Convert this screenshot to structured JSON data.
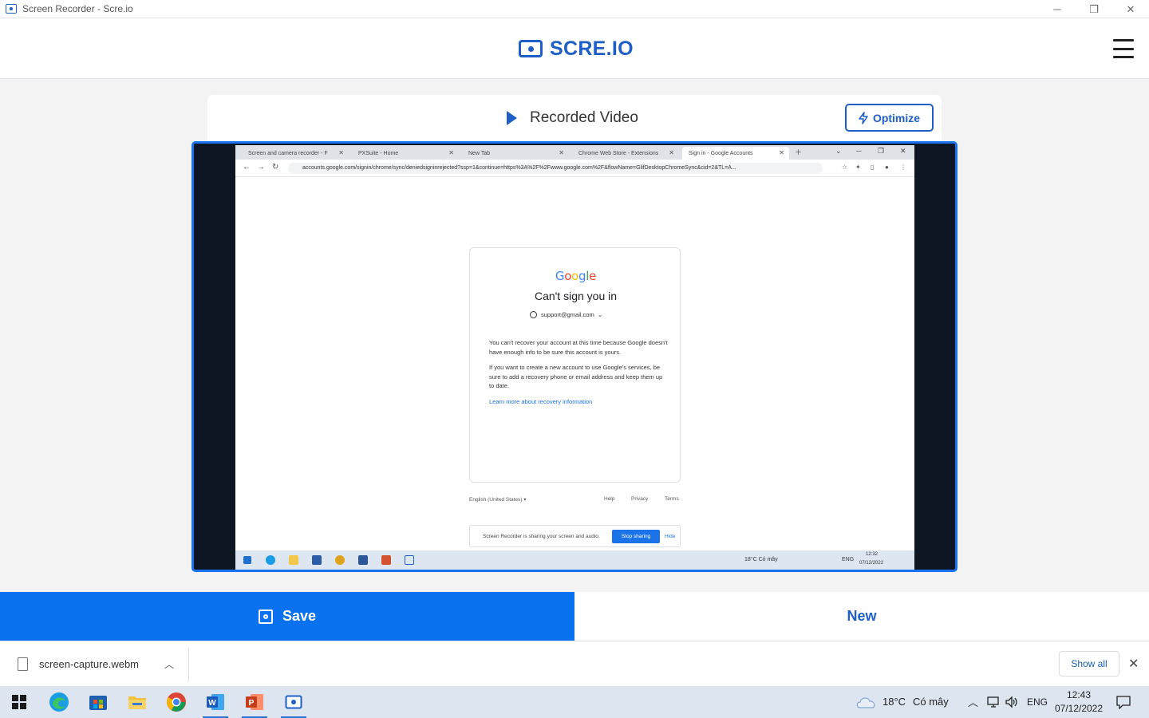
{
  "window": {
    "title": "Screen Recorder - Scre.io",
    "controls": {
      "minimize": "─",
      "maximize": "❐",
      "close": "✕"
    }
  },
  "header": {
    "logo_text": "SCRE.IO"
  },
  "card": {
    "title": "Recorded Video",
    "optimize_label": "Optimize"
  },
  "video": {
    "browser_tabs": [
      "Screen and camera recorder - F",
      "PXSuite - Home",
      "New Tab",
      "Chrome Web Store - Extensions",
      "Sign in - Google Accounts"
    ],
    "url": "accounts.google.com/signin/chrome/sync/deniedsigninrejected?ssp=1&continue=https%3A%2F%2Fwww.google.com%2F&flowName=GlifDesktopChromeSync&cid=2&TL=A...",
    "google": {
      "logo": "Google",
      "title": "Can't sign you in",
      "account": "support@gmail.com",
      "para1": "You can't recover your account at this time because Google doesn't have enough info to be sure this account is yours.",
      "para2": "If you want to create a new account to use Google's services, be sure to add a recovery phone or email address and keep them up to date.",
      "link": "Learn more about recovery information",
      "language": "English (United States)",
      "footer_links": [
        "Help",
        "Privacy",
        "Terms"
      ]
    },
    "share_bar": {
      "text": "Screen Recorder is sharing your screen and audio.",
      "stop": "Stop sharing",
      "hide": "Hide"
    },
    "taskbar": {
      "weather": "18°C  Có mây",
      "lang": "ENG",
      "time": "12:32",
      "date": "07/12/2022"
    }
  },
  "actions": {
    "save_label": "Save",
    "new_label": "New"
  },
  "downloads": {
    "file_name": "screen-capture.webm",
    "show_all": "Show all"
  },
  "taskbar": {
    "weather": "18°C",
    "weather_desc": "Có mây",
    "lang": "ENG",
    "time": "12:43",
    "date": "07/12/2022"
  },
  "colors": {
    "accent": "#1d5fc7",
    "save_bg": "#0a72ee",
    "video_border": "#1a72f0"
  }
}
